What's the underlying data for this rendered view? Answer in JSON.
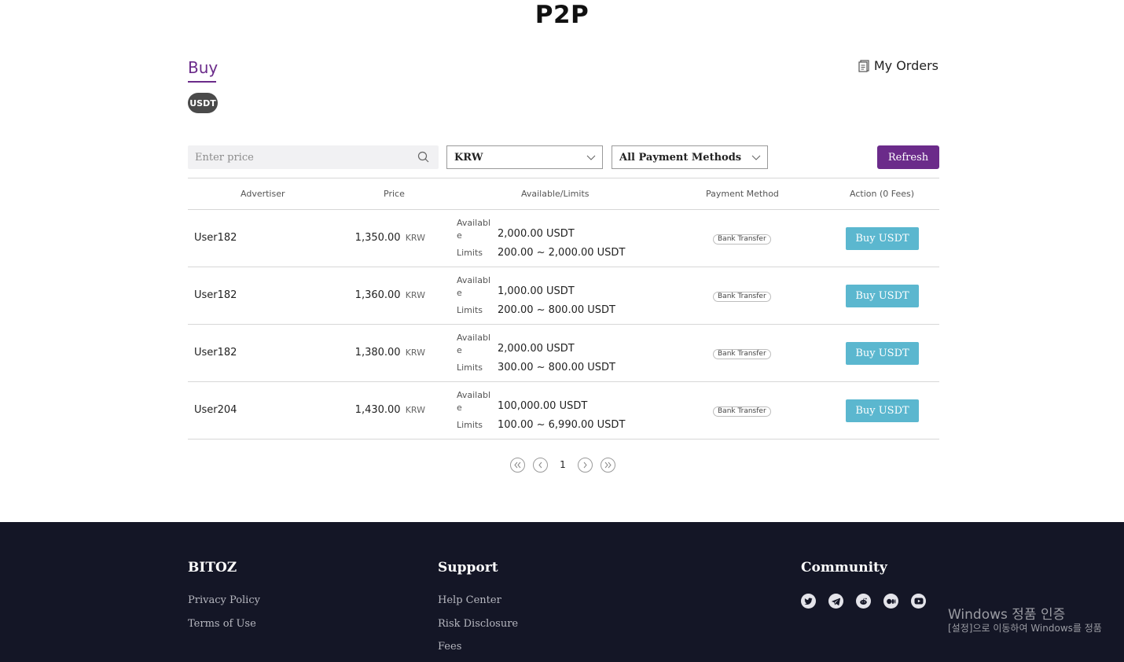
{
  "page": {
    "title": "P2P"
  },
  "tabs": {
    "active": "Buy"
  },
  "coin": {
    "selected": "USDT"
  },
  "header": {
    "my_orders": "My Orders",
    "my_orders_icon": "document-icon"
  },
  "filters": {
    "price_placeholder": "Enter price",
    "currency": "KRW",
    "payment_method": "All Payment Methods",
    "refresh_label": "Refresh"
  },
  "table": {
    "columns": [
      "Advertiser",
      "Price",
      "Available/Limits",
      "Payment Method",
      "Action (0 Fees)"
    ],
    "rows": [
      {
        "advertiser": "User182",
        "price": "1,350.00",
        "price_unit": "KRW",
        "available_label": "Available",
        "available": "2,000.00 USDT",
        "limits_label": "Limits",
        "limits": "200.00 ~ 2,000.00 USDT",
        "payment": "Bank Transfer",
        "action": "Buy USDT"
      },
      {
        "advertiser": "User182",
        "price": "1,360.00",
        "price_unit": "KRW",
        "available_label": "Available",
        "available": "1,000.00 USDT",
        "limits_label": "Limits",
        "limits": "200.00 ~ 800.00 USDT",
        "payment": "Bank Transfer",
        "action": "Buy USDT"
      },
      {
        "advertiser": "User182",
        "price": "1,380.00",
        "price_unit": "KRW",
        "available_label": "Available",
        "available": "2,000.00 USDT",
        "limits_label": "Limits",
        "limits": "300.00 ~ 800.00 USDT",
        "payment": "Bank Transfer",
        "action": "Buy USDT"
      },
      {
        "advertiser": "User204",
        "price": "1,430.00",
        "price_unit": "KRW",
        "available_label": "Available",
        "available": "100,000.00 USDT",
        "limits_label": "Limits",
        "limits": "100.00 ~ 6,990.00 USDT",
        "payment": "Bank Transfer",
        "action": "Buy USDT"
      }
    ]
  },
  "pagination": {
    "current_page": "1"
  },
  "footer": {
    "brand": {
      "title": "BITOZ",
      "links": [
        "Privacy Policy",
        "Terms of Use"
      ]
    },
    "support": {
      "title": "Support",
      "links": [
        "Help Center",
        "Risk Disclosure",
        "Fees"
      ]
    },
    "community": {
      "title": "Community",
      "icons": [
        "twitter-icon",
        "telegram-icon",
        "reddit-icon",
        "medium-icon",
        "youtube-icon"
      ]
    }
  },
  "windows_watermark": {
    "title": "Windows 정품 인증",
    "subtitle": "[설정]으로 이동하여 Windows를 정품"
  },
  "colors": {
    "accent": "#6b2b8a",
    "buy_button": "#5bb7cf",
    "footer_bg": "#141626",
    "chip_bg": "#4a4a4a"
  }
}
